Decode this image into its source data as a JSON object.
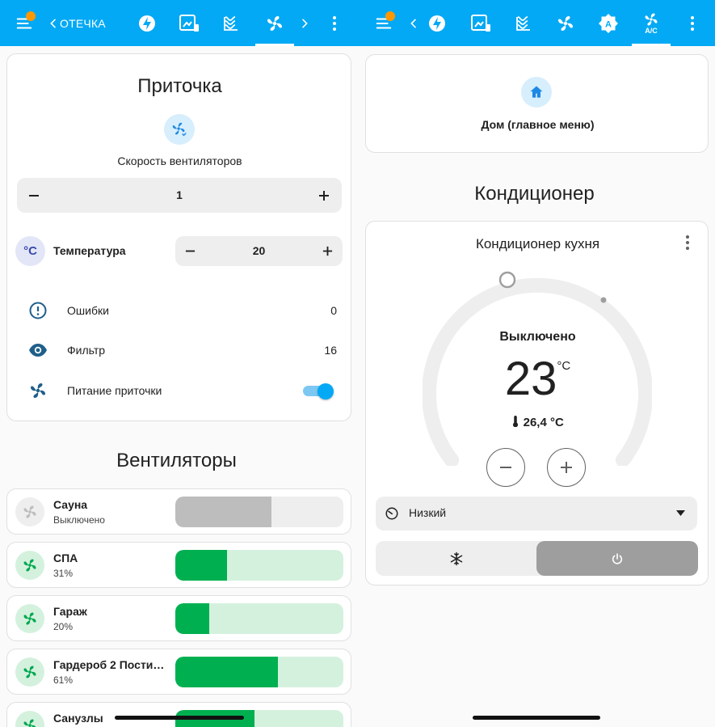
{
  "left": {
    "topbar": {
      "breadcrumb": "ОТЕЧКА",
      "tabs": [
        "back-icon",
        "bolt-icon",
        "monitor-icon",
        "radiator-icon",
        "fan-icon",
        "forward-icon",
        "more-icon"
      ]
    },
    "supply_card": {
      "title": "Приточка",
      "fan_speed_label": "Скорость вентиляторов",
      "fan_speed_value": "1",
      "temp_label": "Температура",
      "temp_value": "20",
      "temp_icon_text": "°C",
      "errors_label": "Ошибки",
      "errors_value": "0",
      "filter_label": "Фильтр",
      "filter_value": "16",
      "power_label": "Питание приточки",
      "power_on": true
    },
    "fans_section_title": "Вентиляторы",
    "fans": [
      {
        "name": "Сауна",
        "state": "Выключено",
        "level": 0.57,
        "on": false
      },
      {
        "name": "СПА",
        "state": "31%",
        "level": 0.31,
        "on": true
      },
      {
        "name": "Гараж",
        "state": "20%",
        "level": 0.2,
        "on": true
      },
      {
        "name": "Гардероб 2 Пости…",
        "state": "61%",
        "level": 0.61,
        "on": true
      },
      {
        "name": "Санузлы",
        "state": "",
        "level": 0.47,
        "on": true
      }
    ],
    "colors": {
      "green": "#00b050",
      "green_light": "#d4f1de",
      "grey": "#bdbdbd",
      "grey_light": "#eeeeee"
    }
  },
  "right": {
    "topbar": {
      "tabs": [
        "back-icon",
        "bolt-icon",
        "monitor-icon",
        "radiator-icon",
        "fan-icon",
        "auto-icon",
        "ac-icon",
        "more-icon"
      ],
      "ac_tab_label": "A/C"
    },
    "home_card": {
      "label": "Дом (главное меню)"
    },
    "section_title": "Кондиционер",
    "climate_card": {
      "title": "Кондиционер кухня",
      "state": "Выключено",
      "target_temp": "23",
      "unit": "°C",
      "current_temp": "26,4 °C",
      "fan_mode": "Низкий"
    }
  },
  "accent": "#03a9f4"
}
